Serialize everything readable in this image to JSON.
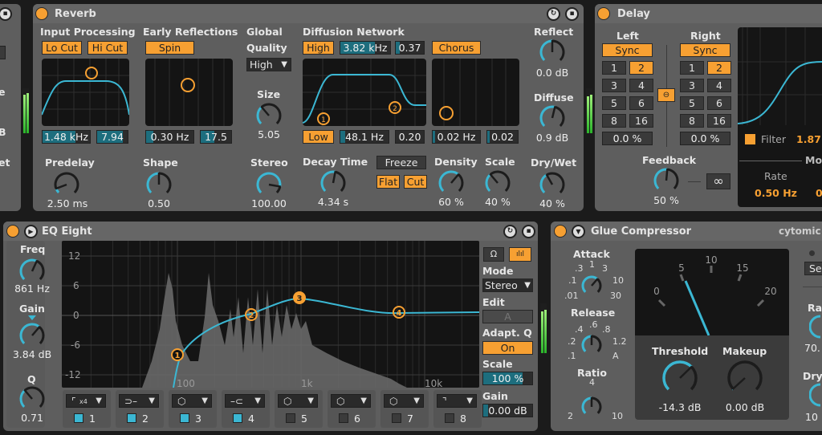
{
  "colors": {
    "accent": "#f7a032",
    "teal": "#3bb7d3",
    "panel": "#5e5e5e",
    "background": "#1b1b1b"
  },
  "left_partial": {
    "labels": [
      "e",
      "B",
      "et"
    ]
  },
  "reverb": {
    "title": "Reverb",
    "input_processing": {
      "label": "Input Processing",
      "lo_cut": "Lo Cut",
      "hi_cut": "Hi Cut",
      "freq": "1.48 kHz",
      "width": "7.94"
    },
    "early_reflections": {
      "label": "Early Reflections",
      "spin": "Spin",
      "rate": "0.30 Hz",
      "amount": "17.5"
    },
    "global": {
      "label": "Global",
      "quality_label": "Quality",
      "quality": "High"
    },
    "diffusion": {
      "label": "Diffusion Network",
      "high": "High",
      "high_freq": "3.82 kHz",
      "high_val": "0.37",
      "chorus": "Chorus",
      "low": "Low",
      "low_freq": "48.1 Hz",
      "low_val": "0.20",
      "chorus_rate": "0.02 Hz",
      "chorus_amount": "0.02"
    },
    "freeze": "Freeze",
    "flat": "Flat",
    "cut": "Cut",
    "knobs": {
      "size": {
        "label": "Size",
        "value": "5.05",
        "level": 0.35
      },
      "predelay": {
        "label": "Predelay",
        "value": "2.50 ms",
        "level": 0.09
      },
      "shape": {
        "label": "Shape",
        "value": "0.50",
        "level": 0.5
      },
      "stereo": {
        "label": "Stereo",
        "value": "100.00",
        "level": 0.87
      },
      "decay": {
        "label": "Decay Time",
        "value": "4.34 s",
        "level": 0.54
      },
      "density": {
        "label": "Density",
        "value": "60 %",
        "level": 0.65
      },
      "scale": {
        "label": "Scale",
        "value": "40 %",
        "level": 0.35
      },
      "drywet": {
        "label": "Dry/Wet",
        "value": "40 %",
        "level": 0.39
      },
      "reflect": {
        "label": "Reflect",
        "value": "0.0 dB",
        "level": 0.5
      },
      "diffuse": {
        "label": "Diffuse",
        "value": "0.9 dB",
        "level": 0.55
      }
    },
    "band_labels": [
      "1",
      "2"
    ]
  },
  "delay": {
    "title": "Delay",
    "left": "Left",
    "right": "Right",
    "sync": "Sync",
    "divisions": [
      "1",
      "2",
      "3",
      "4",
      "5",
      "6",
      "8",
      "16"
    ],
    "selected_division": "2",
    "left_offset": "0.0 %",
    "right_offset": "0.0 %",
    "feedback": {
      "label": "Feedback",
      "value": "50 %",
      "level": 0.52
    },
    "infinity": "∞",
    "filter_label": "Filter",
    "filter_value": "1.87",
    "mod_label": "Mo",
    "rate_label": "Rate",
    "rate_value": "0.50 Hz",
    "rate_partial": "0"
  },
  "eq": {
    "title": "EQ Eight",
    "freq": {
      "label": "Freq",
      "value": "861 Hz",
      "level": 0.59
    },
    "gain": {
      "label": "Gain",
      "value": "3.84 dB",
      "level": 0.65
    },
    "q": {
      "label": "Q",
      "value": "0.71",
      "level": 0.35
    },
    "y_ticks": [
      "12",
      "6",
      "0",
      "-6",
      "-12"
    ],
    "x_ticks": [
      "100",
      "1k",
      "10k"
    ],
    "bands": [
      {
        "num": "1",
        "type": "low-cut-x4",
        "on": true
      },
      {
        "num": "2",
        "type": "low-shelf",
        "on": true
      },
      {
        "num": "3",
        "type": "bell",
        "on": true
      },
      {
        "num": "4",
        "type": "high-shelf",
        "on": true
      },
      {
        "num": "5",
        "type": "bell",
        "on": false
      },
      {
        "num": "6",
        "type": "bell",
        "on": false
      },
      {
        "num": "7",
        "type": "bell",
        "on": false
      },
      {
        "num": "8",
        "type": "high-cut",
        "on": false
      }
    ],
    "band1_badge": "x4",
    "mode_label": "Mode",
    "mode": "Stereo",
    "edit_label": "Edit",
    "edit": "A",
    "adaptq_label": "Adapt. Q",
    "adaptq": "On",
    "scale_label": "Scale",
    "scale": "100 %",
    "scale_level": 1.0,
    "gain_label": "Gain",
    "gain_value": "0.00 dB",
    "gain_level": 0.5
  },
  "glue": {
    "title": "Glue Compressor",
    "brand": "cytomic",
    "attack": {
      "label": "Attack",
      "ticks": [
        ".01",
        ".1",
        ".3",
        "1",
        "3",
        "10",
        "30"
      ],
      "level": 0.65
    },
    "release": {
      "label": "Release",
      "ticks": [
        ".1",
        ".2",
        ".4",
        ".6",
        ".8",
        "1.2",
        "A"
      ],
      "level": 0.5
    },
    "ratio": {
      "label": "Ratio",
      "ticks": [
        "2",
        "4",
        "10"
      ],
      "level": 0.5
    },
    "meter_ticks": [
      "0",
      "5",
      "10",
      "15",
      "20"
    ],
    "threshold": {
      "label": "Threshold",
      "value": "-14.3 dB",
      "level": 0.67
    },
    "makeup": {
      "label": "Makeup",
      "value": "0.00 dB",
      "level": 0.01
    },
    "side_partial": "Se",
    "ratio_partial": "Ra",
    "ratio_value_partial": "70.",
    "drywet_partial": "Dry/",
    "drywet_value_partial": "10"
  }
}
